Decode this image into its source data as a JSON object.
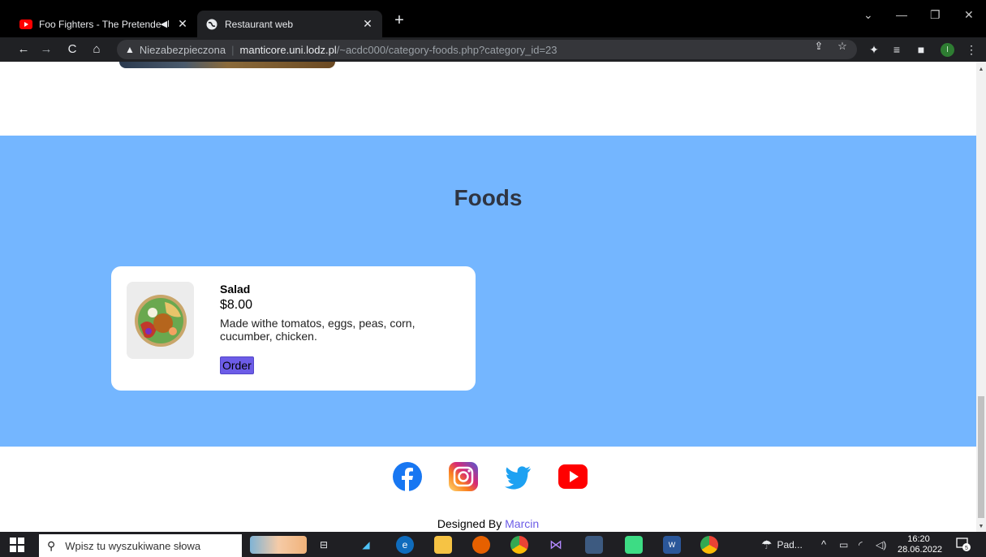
{
  "browser": {
    "tabs": [
      {
        "title": "Foo Fighters - The Pretender",
        "active": false,
        "audio_icon": "speaker-icon"
      },
      {
        "title": "Restaurant web",
        "active": true
      }
    ],
    "address": {
      "security_label": "Niezabezpieczona",
      "host": "manticore.uni.lodz.pl",
      "path": "/~acdc000/category-foods.php?category_id=23"
    },
    "profile_initial": "I"
  },
  "page": {
    "foods_title": "Foods",
    "foods": [
      {
        "name": "Salad",
        "price": "$8.00",
        "description": "Made withe tomatos, eggs, peas, corn, cucumber, chicken.",
        "order_label": "Order"
      }
    ],
    "footer": {
      "designed_prefix": "Designed By",
      "designer": "Marcin"
    },
    "social_icons": [
      "facebook-icon",
      "instagram-icon",
      "twitter-icon",
      "youtube-icon"
    ],
    "colors": {
      "section_bg": "#74b6ff",
      "order_button": "#6c5ce7",
      "title_text": "#2f3542"
    }
  },
  "taskbar": {
    "search_placeholder": "Wpisz tu wyszukiwane słowa",
    "weather_label": "Pad...",
    "time": "16:20",
    "date": "28.06.2022",
    "notification_count": "5"
  }
}
